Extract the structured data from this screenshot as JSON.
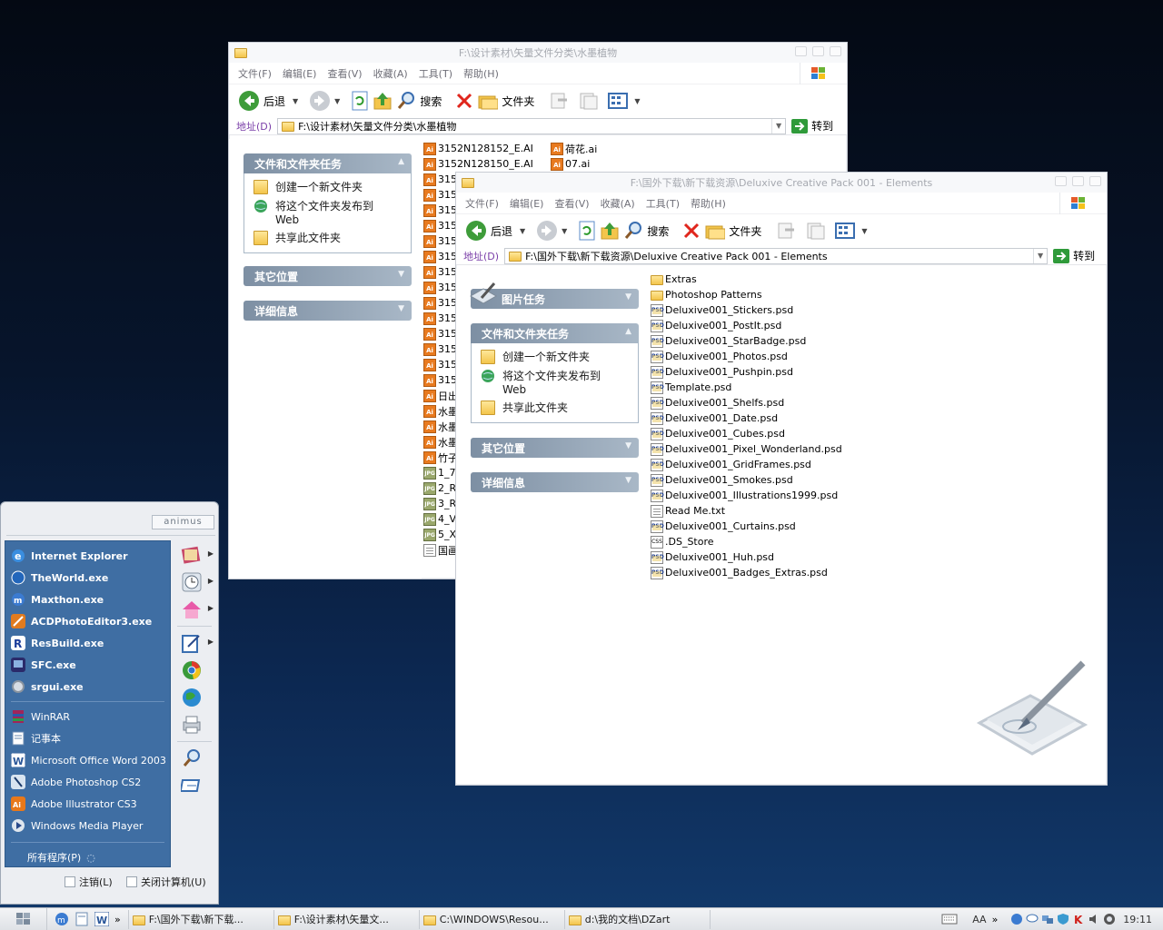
{
  "w1": {
    "title": "F:\\设计素材\\矢量文件分类\\水墨植物",
    "menus": [
      "文件(F)",
      "编辑(E)",
      "查看(V)",
      "收藏(A)",
      "工具(T)",
      "帮助(H)"
    ],
    "back": "后退",
    "search": "搜索",
    "folders": "文件夹",
    "addr_label": "地址(D)",
    "addr_value": "F:\\设计素材\\矢量文件分类\\水墨植物",
    "go": "转到",
    "pane_tasks": "文件和文件夹任务",
    "task1": "创建一个新文件夹",
    "task2": "将这个文件夹发布到",
    "task2b": "Web",
    "task3": "共享此文件夹",
    "pane_other": "其它位置",
    "pane_detail": "详细信息",
    "files_col1": [
      "3152N128152_E.AI",
      "3152N128150_E.AI",
      "315",
      "315",
      "315",
      "315",
      "315",
      "315",
      "315",
      "315",
      "315",
      "315",
      "315",
      "315",
      "315",
      "315",
      "日出",
      "水墨",
      "水墨",
      "水墨",
      "竹子",
      "1_7",
      "2_R",
      "3_R",
      "4_V",
      "5_X",
      "国画"
    ],
    "files_col2": [
      "荷花.ai",
      "07.ai"
    ]
  },
  "w2": {
    "title": "F:\\国外下载\\新下载资源\\Deluxive Creative Pack 001 - Elements",
    "menus": [
      "文件(F)",
      "编辑(E)",
      "查看(V)",
      "收藏(A)",
      "工具(T)",
      "帮助(H)"
    ],
    "back": "后退",
    "search": "搜索",
    "folders": "文件夹",
    "addr_label": "地址(D)",
    "addr_value": "F:\\国外下载\\新下载资源\\Deluxive Creative Pack 001 - Elements",
    "go": "转到",
    "pane_pic": "图片任务",
    "pane_tasks": "文件和文件夹任务",
    "task1": "创建一个新文件夹",
    "task2": "将这个文件夹发布到",
    "task2b": "Web",
    "task3": "共享此文件夹",
    "pane_other": "其它位置",
    "pane_detail": "详细信息",
    "files": [
      {
        "n": "Extras",
        "t": "folder"
      },
      {
        "n": "Photoshop Patterns",
        "t": "folder"
      },
      {
        "n": "Deluxive001_Stickers.psd",
        "t": "psd"
      },
      {
        "n": "Deluxive001_PostIt.psd",
        "t": "psd"
      },
      {
        "n": "Deluxive001_StarBadge.psd",
        "t": "psd"
      },
      {
        "n": "Deluxive001_Photos.psd",
        "t": "psd"
      },
      {
        "n": "Deluxive001_Pushpin.psd",
        "t": "psd"
      },
      {
        "n": "Template.psd",
        "t": "psd"
      },
      {
        "n": "Deluxive001_Shelfs.psd",
        "t": "psd"
      },
      {
        "n": "Deluxive001_Date.psd",
        "t": "psd"
      },
      {
        "n": "Deluxive001_Cubes.psd",
        "t": "psd"
      },
      {
        "n": "Deluxive001_Pixel_Wonderland.psd",
        "t": "psd"
      },
      {
        "n": "Deluxive001_GridFrames.psd",
        "t": "psd"
      },
      {
        "n": "Deluxive001_Smokes.psd",
        "t": "psd"
      },
      {
        "n": "Deluxive001_Illustrations1999.psd",
        "t": "psd"
      },
      {
        "n": "Read Me.txt",
        "t": "txt"
      },
      {
        "n": "Deluxive001_Curtains.psd",
        "t": "psd"
      },
      {
        "n": ".DS_Store",
        "t": "css"
      },
      {
        "n": "Deluxive001_Huh.psd",
        "t": "psd"
      },
      {
        "n": "Deluxive001_Badges_Extras.psd",
        "t": "psd"
      }
    ]
  },
  "start": {
    "user": "animus",
    "pinned": [
      "Internet Explorer",
      "TheWorld.exe",
      "Maxthon.exe",
      "ACDPhotoEditor3.exe",
      "ResBuild.exe",
      "SFC.exe",
      "srgui.exe"
    ],
    "recent": [
      "WinRAR",
      "记事本",
      "Microsoft Office Word 2003",
      "Adobe Photoshop CS2",
      "Adobe Illustrator CS3",
      "Windows Media Player"
    ],
    "all": "所有程序(P)",
    "logoff": "注销(L)",
    "shutdown": "关闭计算机(U)"
  },
  "taskbar": {
    "items": [
      "F:\\国外下载\\新下载...",
      "F:\\设计素材\\矢量文...",
      "C:\\WINDOWS\\Resou...",
      "d:\\我的文档\\DZart"
    ],
    "aa": "AA",
    "chev": "»",
    "clock": "19:11"
  },
  "colors": {
    "pane_header": "#7d8fa3",
    "start_left": "#3f6ea3",
    "address_label": "#7a3ea8"
  }
}
